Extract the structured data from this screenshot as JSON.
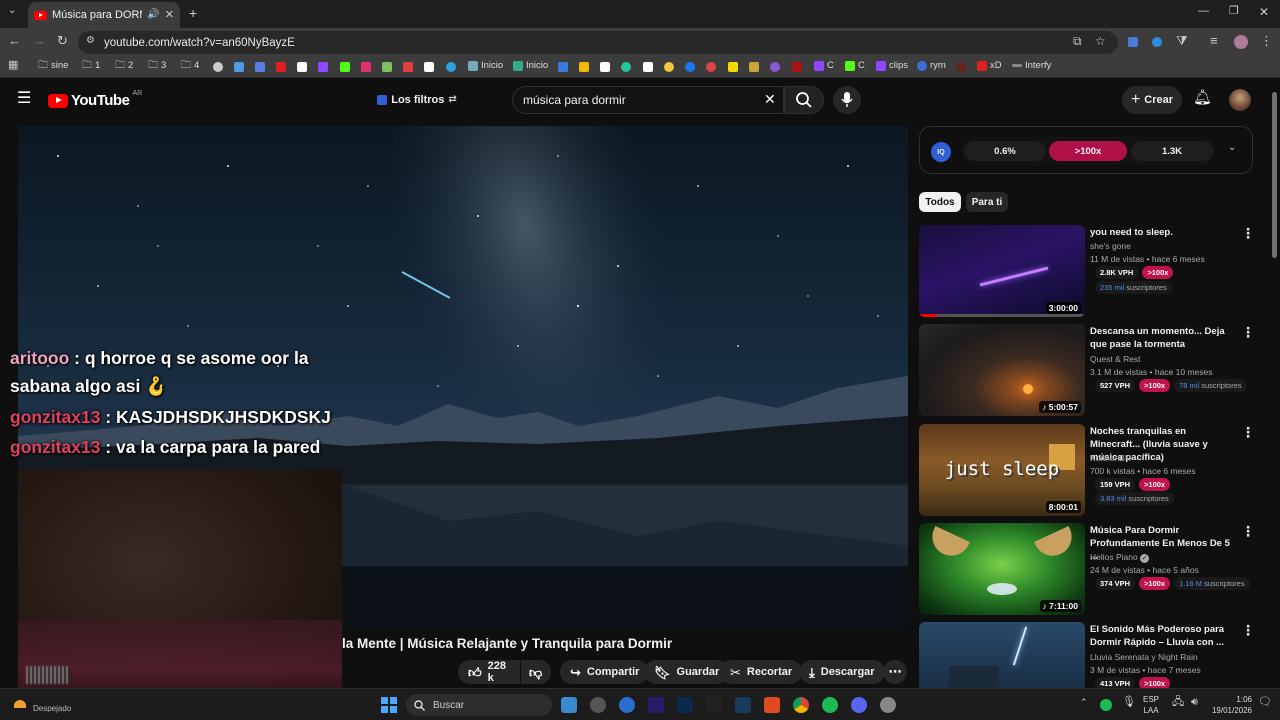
{
  "browser": {
    "tab_title": "Música para DORMIR PROF",
    "url": "youtube.com/watch?v=an60NyBayzE",
    "bookmarks": [
      {
        "label": "sine",
        "icon": "folder-icon"
      },
      {
        "label": "1",
        "icon": "folder-icon"
      },
      {
        "label": "2",
        "icon": "folder-icon"
      },
      {
        "label": "3",
        "icon": "folder-icon"
      },
      {
        "label": "4",
        "icon": "folder-icon"
      },
      {
        "label": "Inicio",
        "icon": "site-icon"
      },
      {
        "label": "Inicio",
        "icon": "site-icon"
      },
      {
        "label": "C",
        "icon": "site-icon"
      },
      {
        "label": "C",
        "icon": "site-icon"
      },
      {
        "label": "clips",
        "icon": "site-icon"
      },
      {
        "label": "rym",
        "icon": "site-icon"
      },
      {
        "label": "xD",
        "icon": "site-icon"
      },
      {
        "label": "Interfy",
        "icon": "site-icon"
      }
    ]
  },
  "youtube": {
    "logo_text": "YouTube",
    "country": "AR",
    "filters_label": "Los filtros",
    "search_value": "música para dormir",
    "create_label": "Crear"
  },
  "video": {
    "title_visible": "la Mente | Música Relajante y Tranquila para Dormir",
    "likes": "228 k",
    "share_label": "Compartir",
    "save_label": "Guardar",
    "clip_label": "Recortar",
    "download_label": "Descargar"
  },
  "chat": [
    {
      "user": "aritooo",
      "text": " : q horroe q se asome oor la"
    },
    {
      "user": "",
      "text": "sabana algo asi 🪝"
    },
    {
      "user": "gonzitax13",
      "text": " : KASJDHSDKJHSDKDSKJ"
    },
    {
      "user": "gonzitax13",
      "text": " : va la carpa para la pared"
    }
  ],
  "iq_bar": {
    "left": "0.6%",
    "middle": ">100x",
    "right": "1.3K"
  },
  "chips": [
    "Todos",
    "Para ti"
  ],
  "recommendations": [
    {
      "title": "you need to sleep.",
      "channel": "she's gone",
      "meta": "11 M de vistas • hace 6 meses",
      "vph": "2.8K VPH",
      "ratio": ">100x",
      "subs_num": "235 mil",
      "subs_label": "suscriptores",
      "duration": "3:00:00"
    },
    {
      "title": "Descansa un momento... Deja que pase la tormenta",
      "channel": "Quest & Rest",
      "meta": "3.1 M de vistas • hace 10 meses",
      "vph": "527 VPH",
      "ratio": ">100x",
      "subs_num": "78 mil",
      "subs_label": "suscriptores",
      "duration": "5:00:57"
    },
    {
      "title": "Noches tranquilas en Minecraft... (lluvia suave y música pacífica)",
      "channel": "KonnonBR",
      "meta": "700 k vistas • hace 6 meses",
      "vph": "159 VPH",
      "ratio": ">100x",
      "subs_num": "3.83 mil",
      "subs_label": "suscriptores",
      "duration": "8:00:01",
      "thumb_text": "just sleep"
    },
    {
      "title": "Música Para Dormir Profundamente En Menos De 5 ...",
      "channel": "Helios Piano",
      "meta": "24 M de vistas • hace 5 años",
      "vph": "374 VPH",
      "ratio": ">100x",
      "subs_num": "1.16 M",
      "subs_label": "suscriptores",
      "duration": "7:11:00"
    },
    {
      "title": "El Sonido Más Poderoso para Dormir Rápido – Lluvia con ...",
      "channel": "Lluvia Serenata y Night Rain",
      "meta": "3 M de vistas • hace 7 meses",
      "vph": "413 VPH",
      "ratio": ">100x",
      "subs_num": "",
      "subs_label": "",
      "duration": ""
    }
  ],
  "taskbar": {
    "weather": "Despejado",
    "search_placeholder": "Buscar",
    "lang": "ESP",
    "lang2": "LAA",
    "time": "1:06",
    "date": "19/01/2026"
  }
}
